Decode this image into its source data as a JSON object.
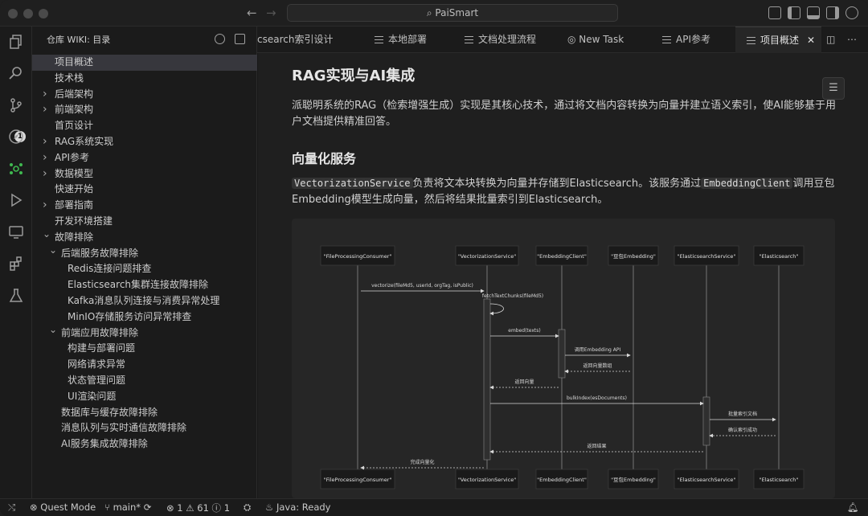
{
  "window": {
    "title": "PaiSmart"
  },
  "sidebar": {
    "title": "仓库 WIKI: 目录",
    "items": [
      {
        "label": "项目概述",
        "level": 0,
        "chevron": "",
        "selected": true
      },
      {
        "label": "技术栈",
        "level": 0,
        "chevron": ""
      },
      {
        "label": "后端架构",
        "level": 0,
        "chevron": "right"
      },
      {
        "label": "前端架构",
        "level": 0,
        "chevron": "right"
      },
      {
        "label": "首页设计",
        "level": 0,
        "chevron": ""
      },
      {
        "label": "RAG系统实现",
        "level": 0,
        "chevron": "right"
      },
      {
        "label": "API参考",
        "level": 0,
        "chevron": "right"
      },
      {
        "label": "数据模型",
        "level": 0,
        "chevron": "right"
      },
      {
        "label": "快速开始",
        "level": 0,
        "chevron": ""
      },
      {
        "label": "部署指南",
        "level": 0,
        "chevron": "right"
      },
      {
        "label": "开发环境搭建",
        "level": 0,
        "chevron": ""
      },
      {
        "label": "故障排除",
        "level": 0,
        "chevron": "down"
      },
      {
        "label": "后端服务故障排除",
        "level": 1,
        "chevron": "down"
      },
      {
        "label": "Redis连接问题排查",
        "level": 2,
        "chevron": ""
      },
      {
        "label": "Elasticsearch集群连接故障排除",
        "level": 2,
        "chevron": ""
      },
      {
        "label": "Kafka消息队列连接与消费异常处理",
        "level": 2,
        "chevron": ""
      },
      {
        "label": "MinIO存储服务访问异常排查",
        "level": 2,
        "chevron": ""
      },
      {
        "label": "前端应用故障排除",
        "level": 1,
        "chevron": "down"
      },
      {
        "label": "构建与部署问题",
        "level": 2,
        "chevron": ""
      },
      {
        "label": "网络请求异常",
        "level": 2,
        "chevron": ""
      },
      {
        "label": "状态管理问题",
        "level": 2,
        "chevron": ""
      },
      {
        "label": "UI渲染问题",
        "level": 2,
        "chevron": ""
      },
      {
        "label": "数据库与缓存故障排除",
        "level": 1,
        "chevron": ""
      },
      {
        "label": "消息队列与实时通信故障排除",
        "level": 1,
        "chevron": ""
      },
      {
        "label": "AI服务集成故障排除",
        "level": 1,
        "chevron": ""
      }
    ]
  },
  "tabs": [
    {
      "label": "csearch索引设计",
      "icon": false
    },
    {
      "label": "本地部署",
      "icon": "list"
    },
    {
      "label": "文档处理流程",
      "icon": "list"
    },
    {
      "label": "New Task",
      "icon": "compass"
    },
    {
      "label": "API参考",
      "icon": "list"
    },
    {
      "label": "项目概述",
      "icon": "list",
      "active": true,
      "close": "✕"
    }
  ],
  "doc": {
    "h1": "RAG实现与AI集成",
    "p1": "派聪明系统的RAG（检索增强生成）实现是其核心技术，通过将文档内容转换为向量并建立语义索引，使AI能够基于用户文档提供精准回答。",
    "h2": "向量化服务",
    "p2_code1": "VectorizationService",
    "p2_text1": "负责将文本块转换为向量并存储到Elasticsearch。该服务通过",
    "p2_code2": "EmbeddingClient",
    "p2_text2": "调用豆包Embedding模型生成向量，然后将结果批量索引到Elasticsearch。"
  },
  "diagram": {
    "participants": [
      "\"FileProcessingConsumer\"",
      "\"VectorizationService\"",
      "\"EmbeddingClient\"",
      "\"豆包Embedding\"",
      "\"ElasticsearchService\"",
      "\"Elasticsearch\""
    ],
    "messages": [
      {
        "from": 0,
        "to": 1,
        "label": "vectorize(fileMd5, userId, orgTag, isPublic)",
        "dashed": false
      },
      {
        "from": 1,
        "to": 1,
        "label": "fetchTextChunks(fileMd5)",
        "dashed": false
      },
      {
        "from": 1,
        "to": 2,
        "label": "embed(texts)",
        "dashed": false
      },
      {
        "from": 2,
        "to": 3,
        "label": "调用Embedding API",
        "dashed": false
      },
      {
        "from": 3,
        "to": 2,
        "label": "返回向量数组",
        "dashed": true
      },
      {
        "from": 2,
        "to": 1,
        "label": "返回向量",
        "dashed": true
      },
      {
        "from": 1,
        "to": 4,
        "label": "bulkIndex(esDocuments)",
        "dashed": false
      },
      {
        "from": 4,
        "to": 5,
        "label": "批量索引文档",
        "dashed": false
      },
      {
        "from": 5,
        "to": 4,
        "label": "确认索引成功",
        "dashed": true
      },
      {
        "from": 4,
        "to": 1,
        "label": "返回结果",
        "dashed": true
      },
      {
        "from": 1,
        "to": 0,
        "label": "完成向量化",
        "dashed": true
      }
    ]
  },
  "statusbar": {
    "mode": "Quest Mode",
    "branch": "main*",
    "errors": "1",
    "warnings": "61",
    "info": "1",
    "java": "Java: Ready"
  },
  "badges": {
    "scm": "1"
  },
  "colors": {
    "accent_green": "#3fb950",
    "selection": "#37373d"
  }
}
